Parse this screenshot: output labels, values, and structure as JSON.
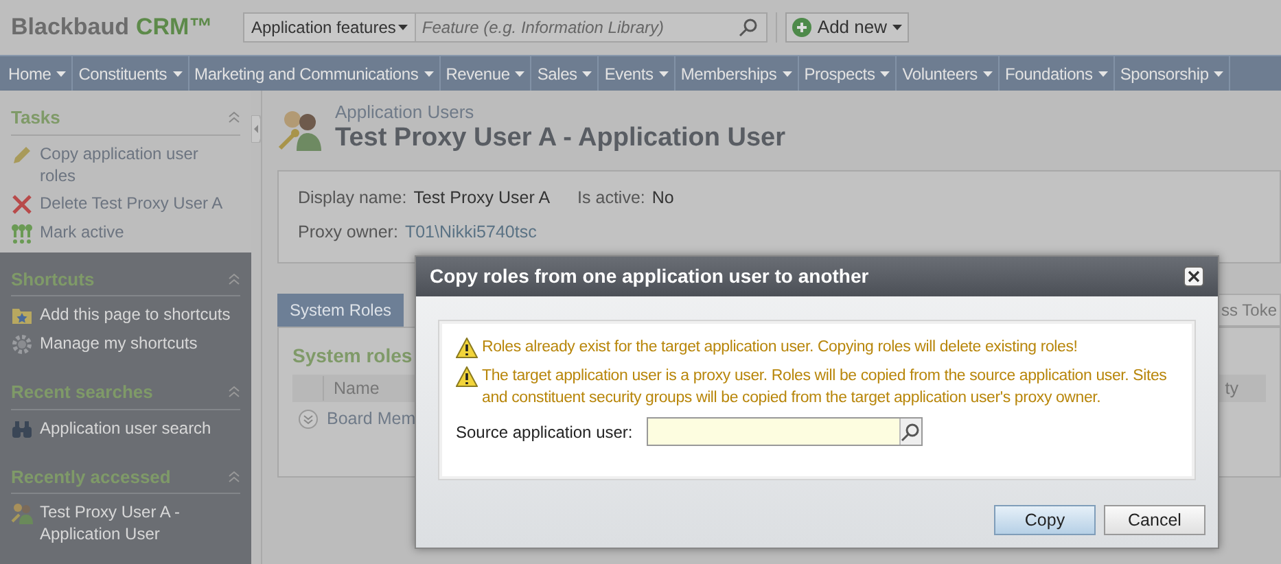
{
  "header": {
    "brand": "Blackbaud",
    "brand_accent": "CRM™",
    "search_scope": "Application features",
    "search_placeholder": "Feature (e.g. Information Library)",
    "add_button": "Add new"
  },
  "nav": [
    "Home",
    "Constituents",
    "Marketing and Communications",
    "Revenue",
    "Sales",
    "Events",
    "Memberships",
    "Prospects",
    "Volunteers",
    "Foundations",
    "Sponsorship"
  ],
  "sidebar": [
    {
      "title": "Tasks",
      "light": true,
      "items": [
        {
          "label": "Copy application user roles",
          "kind": "edit"
        },
        {
          "label": "Delete Test Proxy User A",
          "kind": "delete"
        },
        {
          "label": "Mark active",
          "kind": "activate"
        }
      ]
    },
    {
      "title": "Shortcuts",
      "light": false,
      "items": [
        {
          "label": "Add this page to shortcuts",
          "kind": "folder"
        },
        {
          "label": "Manage my shortcuts",
          "kind": "gear"
        }
      ]
    },
    {
      "title": "Recent searches",
      "light": false,
      "items": [
        {
          "label": "Application user search",
          "kind": "binoculars"
        }
      ]
    },
    {
      "title": "Recently accessed",
      "light": false,
      "items": [
        {
          "label": "Test Proxy User A - Application User",
          "kind": "users"
        }
      ]
    }
  ],
  "page": {
    "breadcrumb": "Application Users",
    "title": "Test Proxy User A - Application User",
    "fields": [
      {
        "label": "Display name:",
        "value": "Test Proxy User A",
        "link": false
      },
      {
        "label": "Is active:",
        "value": "No",
        "link": false
      },
      {
        "label": "Proxy owner:",
        "value": "T01\\Nikki5740tsc",
        "link": true
      }
    ],
    "tabs": [
      {
        "label": "System Roles",
        "selected": true
      },
      {
        "label": "ss Toke",
        "selected": false
      }
    ],
    "section_title": "System roles",
    "columns": [
      "Name",
      "ty"
    ],
    "rows": [
      "Board Mem"
    ]
  },
  "dialog": {
    "title": "Copy roles from one application user to another",
    "warnings": [
      "Roles already exist for the target application user. Copying roles will delete existing roles!",
      "The target application user is a proxy user. Roles will be copied from the source application user. Sites and constituent security groups will be copied from the target application user's proxy owner."
    ],
    "field_label": "Source application user:",
    "buttons": [
      {
        "label": "Copy",
        "primary": true
      },
      {
        "label": "Cancel",
        "primary": false
      }
    ]
  }
}
